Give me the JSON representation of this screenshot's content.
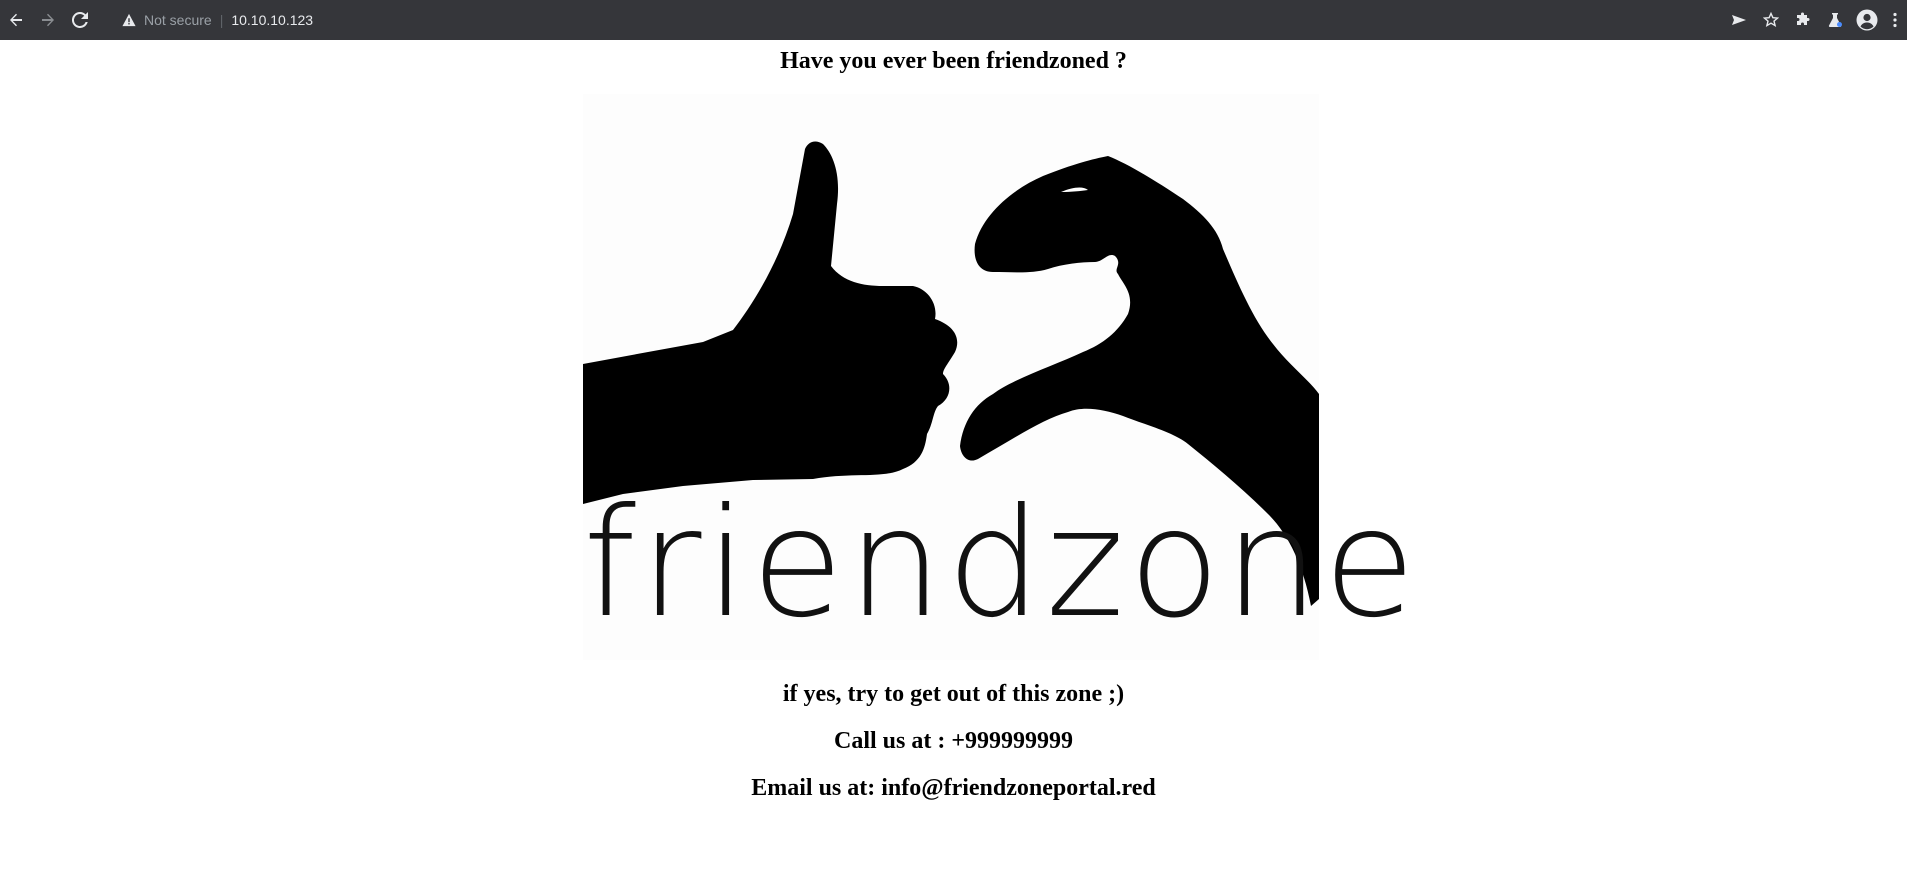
{
  "browser": {
    "security_label": "Not secure",
    "url": "10.10.10.123"
  },
  "icons": {
    "back": "arrow-left",
    "forward": "arrow-right",
    "reload": "reload",
    "warning": "warning-triangle",
    "send": "send-arrow",
    "bookmark": "star",
    "extensions": "puzzle-piece",
    "labs": "flask",
    "profile": "account-circle",
    "menu": "three-dots-vertical"
  },
  "page": {
    "heading": "Have you ever been friendzoned ?",
    "logo_text": "friendzone",
    "line1": "if yes, try to get out of this zone ;)",
    "line2": "Call us at : +999999999",
    "line3": "Email us at: info@friendzoneportal.red"
  },
  "colors": {
    "toolbar_bg": "#35363a",
    "page_bg": "#ffffff",
    "text": "#000000"
  }
}
